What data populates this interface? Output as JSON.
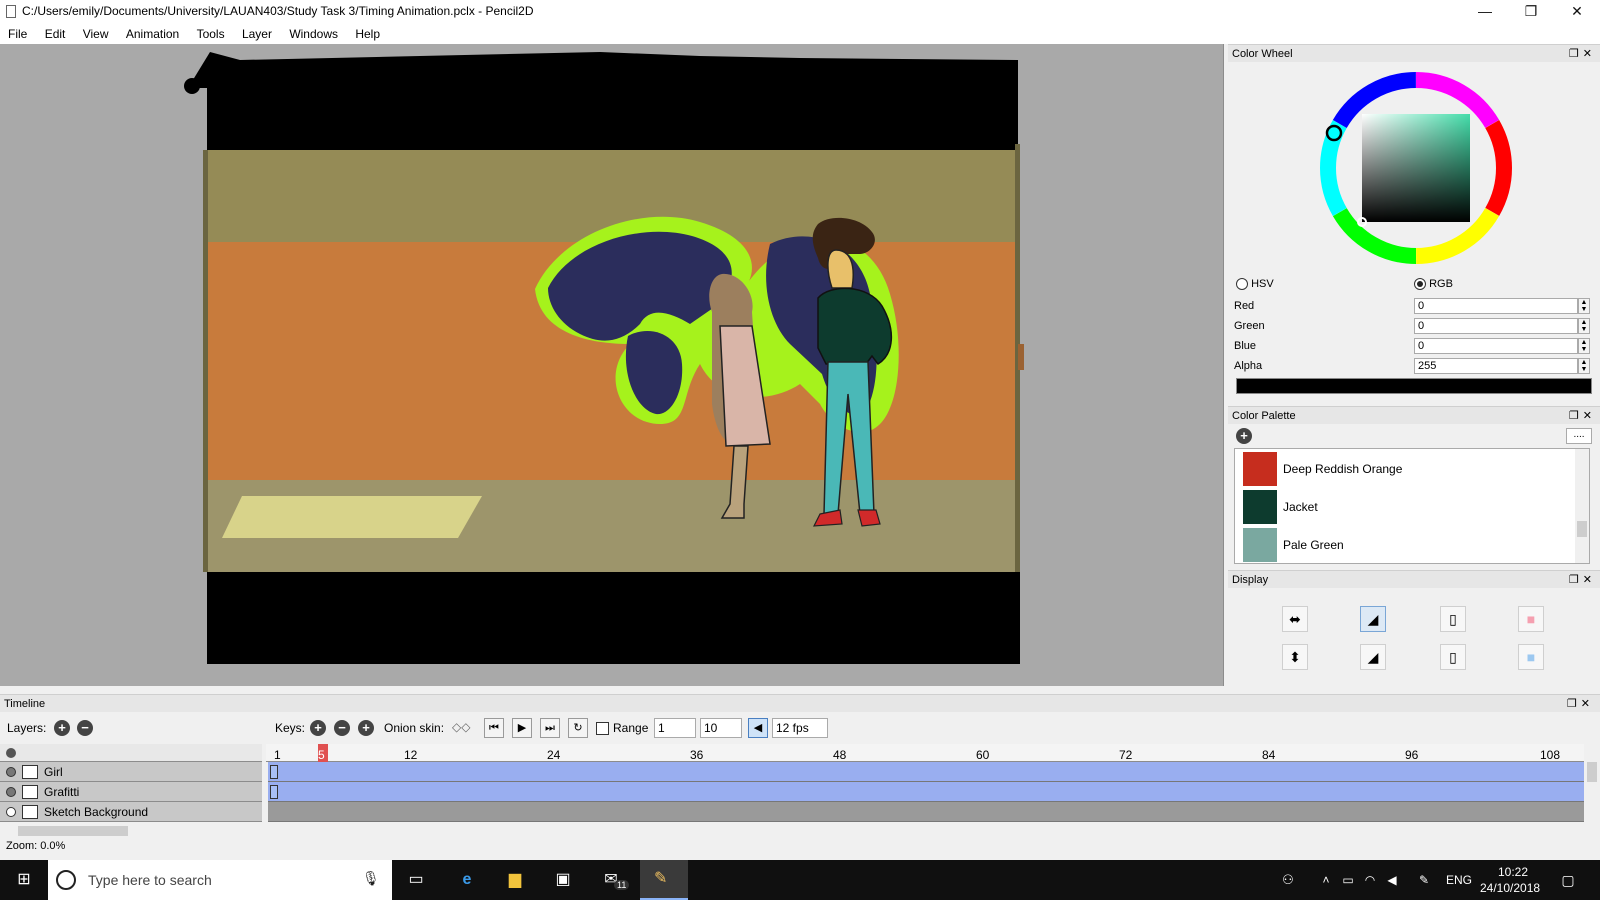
{
  "window": {
    "title": "C:/Users/emily/Documents/University/LAUAN403/Study Task 3/Timing Animation.pclx - Pencil2D",
    "minimize": "—",
    "maximize": "❐",
    "close": "✕"
  },
  "menu": [
    "File",
    "Edit",
    "View",
    "Animation",
    "Tools",
    "Layer",
    "Windows",
    "Help"
  ],
  "color_wheel": {
    "title": "Color Wheel",
    "hsv_label": "HSV",
    "rgb_label": "RGB",
    "mode": "RGB",
    "red_label": "Red",
    "red": "0",
    "green_label": "Green",
    "green": "0",
    "blue_label": "Blue",
    "blue": "0",
    "alpha_label": "Alpha",
    "alpha": "255",
    "current_color": "#000000"
  },
  "color_palette": {
    "title": "Color Palette",
    "more_label": "....",
    "items": [
      {
        "name": "Deep Reddish Orange",
        "color": "#c62d1e"
      },
      {
        "name": "Jacket",
        "color": "#0d3b2e"
      },
      {
        "name": "Pale Green",
        "color": "#7aa8a0"
      }
    ]
  },
  "display": {
    "title": "Display",
    "buttons": [
      "flip-horizontal-icon",
      "outline-icon",
      "onion-prev-icon",
      "color-tint-red-icon",
      "flip-vertical-icon",
      "thin-lines-icon",
      "onion-next-icon",
      "color-tint-blue-icon"
    ]
  },
  "timeline": {
    "title": "Timeline",
    "layers_label": "Layers:",
    "keys_label": "Keys:",
    "onion_label": "Onion skin:",
    "range_label": "Range",
    "range_start": "1",
    "range_end": "10",
    "fps": "12 fps",
    "current_frame": 5,
    "ruler": [
      "1",
      "12",
      "24",
      "36",
      "48",
      "60",
      "72",
      "84",
      "96",
      "108"
    ],
    "layers": [
      {
        "name": "Girl",
        "visible": true
      },
      {
        "name": "Grafitti",
        "visible": true
      },
      {
        "name": "Sketch Background",
        "visible": false
      }
    ],
    "zoom": "Zoom: 0.0%"
  },
  "taskbar": {
    "search_placeholder": "Type here to search",
    "lang": "ENG",
    "time": "10:22",
    "date": "24/10/2018",
    "mail_badge": "11"
  }
}
